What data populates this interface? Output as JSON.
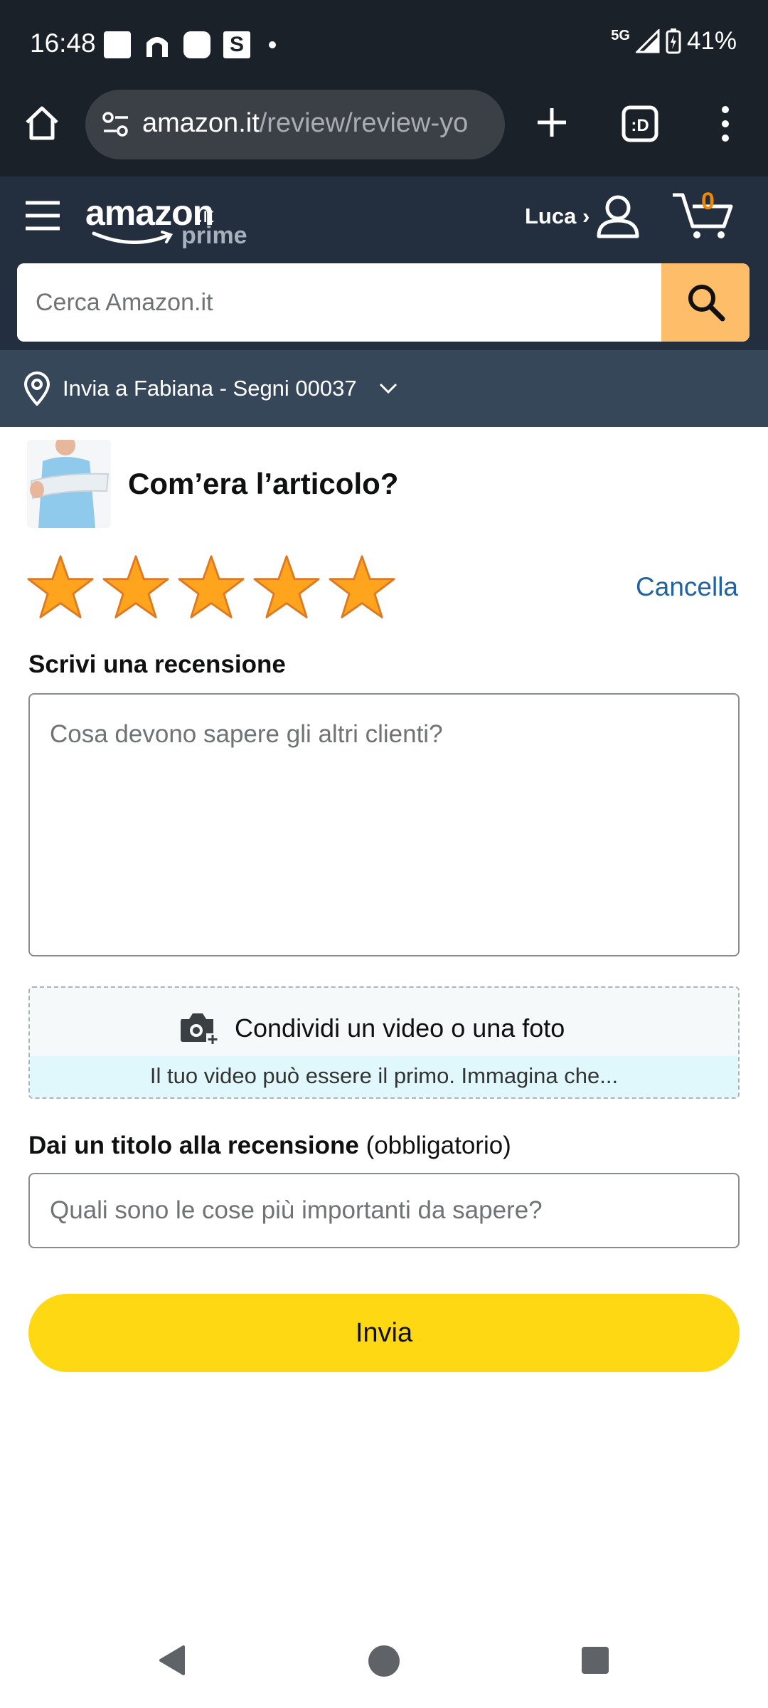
{
  "status_bar": {
    "time": "16:48",
    "network": "5G",
    "battery": "41%"
  },
  "browser": {
    "url_domain": "amazon.it",
    "url_path": "/review/review-yo"
  },
  "header": {
    "logo_main": "amazon",
    "logo_tld": ".it",
    "logo_sub": "prime",
    "user_label": "Luca ›",
    "cart_count": "0",
    "search_placeholder": "Cerca Amazon.it"
  },
  "location": {
    "text": "Invia a Fabiana - Segni 00037"
  },
  "review": {
    "question": "Com’era l’articolo?",
    "rating": 5,
    "rating_max": 5,
    "cancel_label": "Cancella",
    "write_label": "Scrivi una recensione",
    "write_placeholder": "Cosa devono sapere gli altri clienti?",
    "media_label": "Condividi un video o una foto",
    "media_hint": "Il tuo video può essere il primo. Immagina che...",
    "title_label": "Dai un titolo alla recensione",
    "title_required": "(obbligatorio)",
    "title_placeholder": "Quali sono le cose più importanti da sapere?",
    "submit_label": "Invia"
  },
  "colors": {
    "header_bg": "#232f3e",
    "location_bg": "#37475a",
    "star": "#ffa41c",
    "submit": "#ffd814",
    "link": "#2162a1",
    "search_button": "#febd69"
  }
}
